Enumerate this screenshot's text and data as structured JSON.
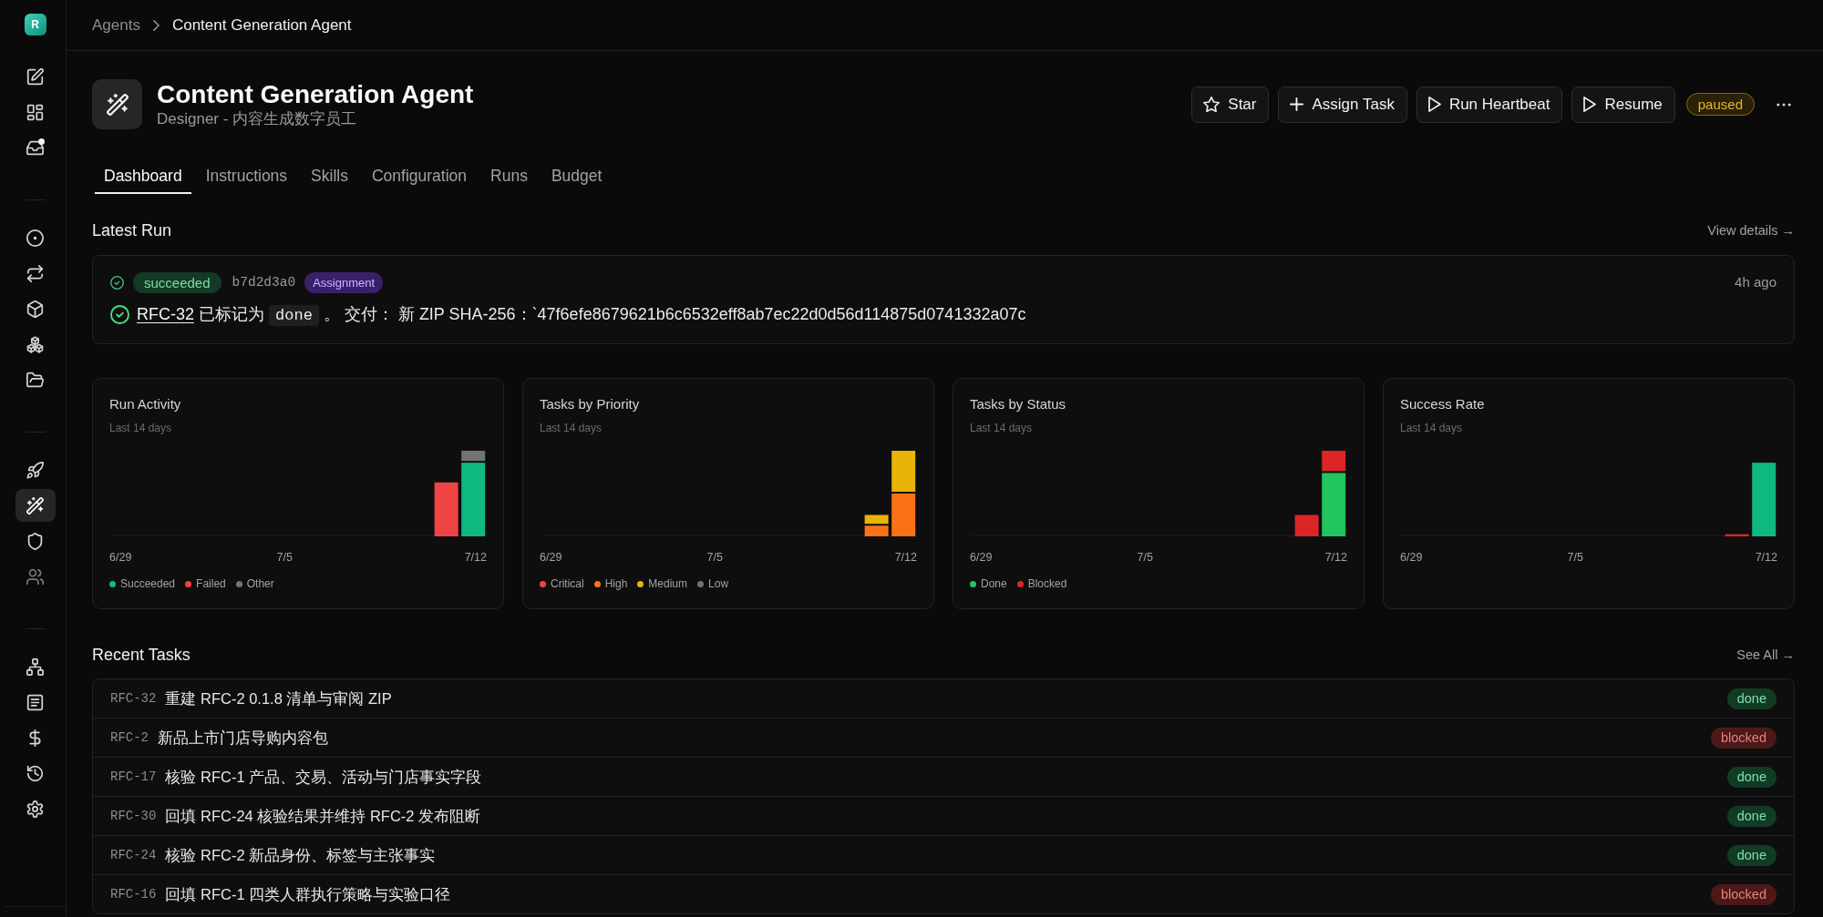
{
  "sidebar": {
    "logo": "R",
    "groups": [
      [
        {
          "selected": false,
          "unread": false,
          "disabled": false
        },
        {
          "selected": false,
          "unread": false,
          "disabled": false
        },
        {
          "selected": false,
          "unread": true,
          "disabled": false
        }
      ],
      [
        {
          "selected": false,
          "unread": false,
          "disabled": false
        },
        {
          "selected": false,
          "unread": false,
          "disabled": false
        },
        {
          "selected": false,
          "unread": false,
          "disabled": false
        },
        {
          "selected": false,
          "unread": false,
          "disabled": false
        },
        {
          "selected": false,
          "unread": false,
          "disabled": false
        }
      ],
      [
        {
          "selected": false,
          "unread": false,
          "disabled": false
        },
        {
          "selected": true,
          "unread": false,
          "disabled": false
        },
        {
          "selected": false,
          "unread": false,
          "disabled": false
        },
        {
          "selected": false,
          "unread": false,
          "disabled": true
        }
      ],
      [
        {
          "selected": false,
          "unread": false,
          "disabled": false
        },
        {
          "selected": false,
          "unread": false,
          "disabled": false
        },
        {
          "selected": false,
          "unread": false,
          "disabled": false
        },
        {
          "selected": false,
          "unread": false,
          "disabled": false
        },
        {
          "selected": false,
          "unread": false,
          "disabled": false
        }
      ]
    ]
  },
  "breadcrumb": {
    "parent": "Agents",
    "current": "Content Generation Agent"
  },
  "agent": {
    "name": "Content Generation Agent",
    "subtitle": "Designer - 内容生成数字员工",
    "actions": [
      "Star",
      "Assign Task",
      "Run Heartbeat",
      "Resume"
    ],
    "status": "paused"
  },
  "tabs": [
    {
      "label": "Dashboard",
      "selected": true
    },
    {
      "label": "Instructions",
      "selected": false
    },
    {
      "label": "Skills",
      "selected": false
    },
    {
      "label": "Configuration",
      "selected": false
    },
    {
      "label": "Runs",
      "selected": false
    },
    {
      "label": "Budget",
      "selected": false
    }
  ],
  "latest_run": {
    "heading": "Latest Run",
    "link": "View details →",
    "status": "succeeded",
    "run_id": "b7d2d3a0",
    "trigger": "Assignment",
    "time": "4h ago",
    "message": {
      "task": "RFC-32",
      "text": "已标记为",
      "code": "done",
      "rest": "。 交付： 新 ZIP SHA-256：`47f6efe8679621b6c6532eff8ab7ec22d0d56d114875d0741332a07c"
    }
  },
  "charts": [
    {
      "kind": "activity",
      "title": "Run Activity",
      "subtitle": "Last 14 days",
      "x_labels": [
        "6/29",
        "7/5",
        "7/12"
      ],
      "legend": [
        {
          "label": "Succeeded",
          "color": "#10b981"
        },
        {
          "label": "Failed",
          "color": "#ef4444"
        },
        {
          "label": "Other",
          "color": "#737373"
        }
      ]
    },
    {
      "kind": "priority",
      "title": "Tasks by Priority",
      "subtitle": "Last 14 days",
      "x_labels": [
        "6/29",
        "7/5",
        "7/12"
      ],
      "legend": [
        {
          "label": "Critical",
          "color": "#ef4444"
        },
        {
          "label": "High",
          "color": "#f97316"
        },
        {
          "label": "Medium",
          "color": "#eab308"
        },
        {
          "label": "Low",
          "color": "#737373"
        }
      ]
    },
    {
      "kind": "status",
      "title": "Tasks by Status",
      "subtitle": "Last 14 days",
      "x_labels": [
        "6/29",
        "7/5",
        "7/12"
      ],
      "legend": [
        {
          "label": "Done",
          "color": "#22c55e"
        },
        {
          "label": "Blocked",
          "color": "#dc2626"
        }
      ]
    },
    {
      "kind": "rate",
      "title": "Success Rate",
      "subtitle": "Last 14 days",
      "x_labels": [
        "6/29",
        "7/5",
        "7/12"
      ]
    }
  ],
  "recent_tasks": {
    "heading": "Recent Tasks",
    "link": "See All →",
    "rows": [
      {
        "id": "RFC-32",
        "title": "重建 RFC-2 0.1.8 清单与审阅 ZIP",
        "status": "done",
        "color": "#123b25"
      },
      {
        "id": "RFC-2",
        "title": "新品上市门店导购内容包",
        "status": "blocked",
        "color": "#4d1818"
      },
      {
        "id": "RFC-17",
        "title": "核验 RFC-1 产品、交易、活动与门店事实字段",
        "status": "done",
        "color": "#123b25"
      },
      {
        "id": "RFC-30",
        "title": "回填 RFC-24 核验结果并维持 RFC-2 发布阻断",
        "status": "done",
        "color": "#123b25"
      },
      {
        "id": "RFC-24",
        "title": "核验 RFC-2 新品身份、标签与主张事实",
        "status": "done",
        "color": "#123b25"
      },
      {
        "id": "RFC-16",
        "title": "回填 RFC-1 四类人群执行策略与实验口径",
        "status": "blocked",
        "color": "#4d1818"
      }
    ]
  }
}
